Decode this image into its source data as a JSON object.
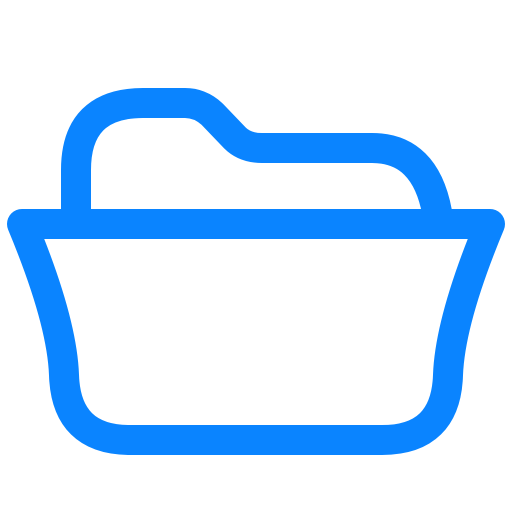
{
  "icon": {
    "name": "folder-open-icon",
    "stroke_color": "#0A84FF",
    "background_color": "#FFFFFF"
  }
}
